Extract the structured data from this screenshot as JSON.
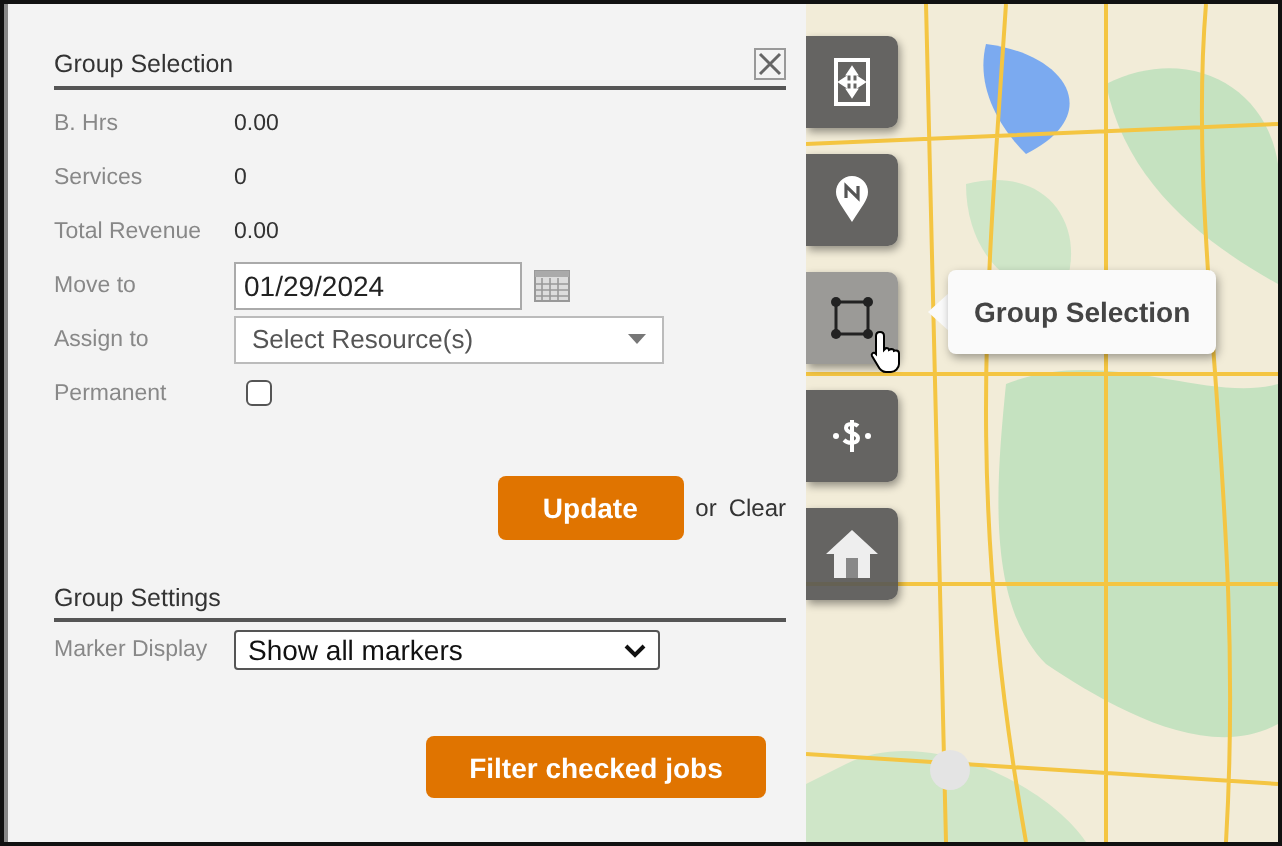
{
  "panel": {
    "title": "Group Selection",
    "fields": [
      {
        "kind": "value",
        "label": "B. Hrs",
        "value": "0.00"
      },
      {
        "kind": "value",
        "label": "Services",
        "value": "0"
      },
      {
        "kind": "value",
        "label": "Total Revenue",
        "value": "0.00"
      },
      {
        "kind": "date",
        "label": "Move to",
        "value": "01/29/2024"
      },
      {
        "kind": "select",
        "label": "Assign to",
        "placeholder": "Select Resource(s)"
      },
      {
        "kind": "checkbox",
        "label": "Permanent",
        "checked": false
      }
    ],
    "update_button": "Update",
    "or_text": "or",
    "clear_link": "Clear",
    "settings": {
      "title": "Group Settings",
      "marker_display": {
        "label": "Marker Display",
        "value": "Show all markers"
      }
    },
    "filter_button": "Filter checked jobs"
  },
  "map": {
    "tools": [
      {
        "kind": "move",
        "selected": false
      },
      {
        "kind": "pin",
        "selected": false
      },
      {
        "kind": "select",
        "selected": true
      },
      {
        "kind": "dollar",
        "selected": false
      },
      {
        "kind": "home",
        "selected": false
      }
    ],
    "tooltip": "Group Selection"
  }
}
